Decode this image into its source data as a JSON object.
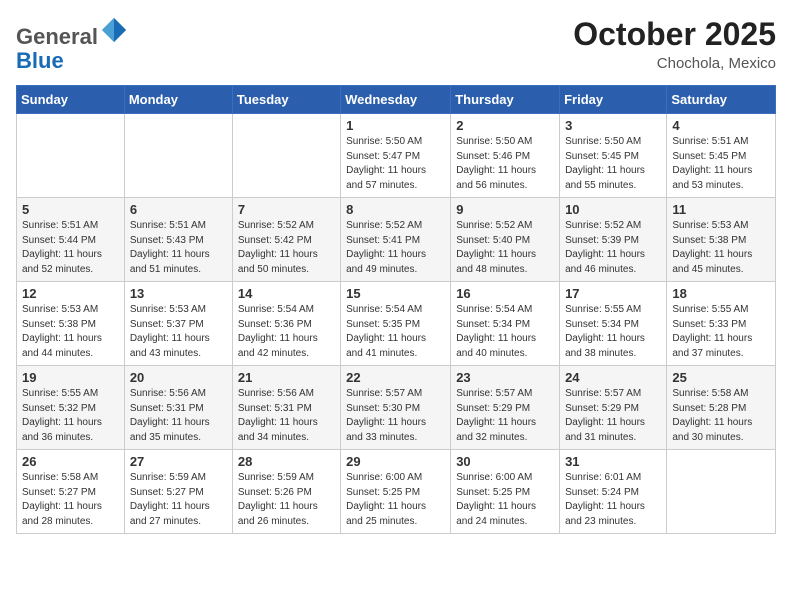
{
  "header": {
    "logo_general": "General",
    "logo_blue": "Blue",
    "month": "October 2025",
    "location": "Chochola, Mexico"
  },
  "weekdays": [
    "Sunday",
    "Monday",
    "Tuesday",
    "Wednesday",
    "Thursday",
    "Friday",
    "Saturday"
  ],
  "weeks": [
    [
      {
        "day": "",
        "info": ""
      },
      {
        "day": "",
        "info": ""
      },
      {
        "day": "",
        "info": ""
      },
      {
        "day": "1",
        "info": "Sunrise: 5:50 AM\nSunset: 5:47 PM\nDaylight: 11 hours\nand 57 minutes."
      },
      {
        "day": "2",
        "info": "Sunrise: 5:50 AM\nSunset: 5:46 PM\nDaylight: 11 hours\nand 56 minutes."
      },
      {
        "day": "3",
        "info": "Sunrise: 5:50 AM\nSunset: 5:45 PM\nDaylight: 11 hours\nand 55 minutes."
      },
      {
        "day": "4",
        "info": "Sunrise: 5:51 AM\nSunset: 5:45 PM\nDaylight: 11 hours\nand 53 minutes."
      }
    ],
    [
      {
        "day": "5",
        "info": "Sunrise: 5:51 AM\nSunset: 5:44 PM\nDaylight: 11 hours\nand 52 minutes."
      },
      {
        "day": "6",
        "info": "Sunrise: 5:51 AM\nSunset: 5:43 PM\nDaylight: 11 hours\nand 51 minutes."
      },
      {
        "day": "7",
        "info": "Sunrise: 5:52 AM\nSunset: 5:42 PM\nDaylight: 11 hours\nand 50 minutes."
      },
      {
        "day": "8",
        "info": "Sunrise: 5:52 AM\nSunset: 5:41 PM\nDaylight: 11 hours\nand 49 minutes."
      },
      {
        "day": "9",
        "info": "Sunrise: 5:52 AM\nSunset: 5:40 PM\nDaylight: 11 hours\nand 48 minutes."
      },
      {
        "day": "10",
        "info": "Sunrise: 5:52 AM\nSunset: 5:39 PM\nDaylight: 11 hours\nand 46 minutes."
      },
      {
        "day": "11",
        "info": "Sunrise: 5:53 AM\nSunset: 5:38 PM\nDaylight: 11 hours\nand 45 minutes."
      }
    ],
    [
      {
        "day": "12",
        "info": "Sunrise: 5:53 AM\nSunset: 5:38 PM\nDaylight: 11 hours\nand 44 minutes."
      },
      {
        "day": "13",
        "info": "Sunrise: 5:53 AM\nSunset: 5:37 PM\nDaylight: 11 hours\nand 43 minutes."
      },
      {
        "day": "14",
        "info": "Sunrise: 5:54 AM\nSunset: 5:36 PM\nDaylight: 11 hours\nand 42 minutes."
      },
      {
        "day": "15",
        "info": "Sunrise: 5:54 AM\nSunset: 5:35 PM\nDaylight: 11 hours\nand 41 minutes."
      },
      {
        "day": "16",
        "info": "Sunrise: 5:54 AM\nSunset: 5:34 PM\nDaylight: 11 hours\nand 40 minutes."
      },
      {
        "day": "17",
        "info": "Sunrise: 5:55 AM\nSunset: 5:34 PM\nDaylight: 11 hours\nand 38 minutes."
      },
      {
        "day": "18",
        "info": "Sunrise: 5:55 AM\nSunset: 5:33 PM\nDaylight: 11 hours\nand 37 minutes."
      }
    ],
    [
      {
        "day": "19",
        "info": "Sunrise: 5:55 AM\nSunset: 5:32 PM\nDaylight: 11 hours\nand 36 minutes."
      },
      {
        "day": "20",
        "info": "Sunrise: 5:56 AM\nSunset: 5:31 PM\nDaylight: 11 hours\nand 35 minutes."
      },
      {
        "day": "21",
        "info": "Sunrise: 5:56 AM\nSunset: 5:31 PM\nDaylight: 11 hours\nand 34 minutes."
      },
      {
        "day": "22",
        "info": "Sunrise: 5:57 AM\nSunset: 5:30 PM\nDaylight: 11 hours\nand 33 minutes."
      },
      {
        "day": "23",
        "info": "Sunrise: 5:57 AM\nSunset: 5:29 PM\nDaylight: 11 hours\nand 32 minutes."
      },
      {
        "day": "24",
        "info": "Sunrise: 5:57 AM\nSunset: 5:29 PM\nDaylight: 11 hours\nand 31 minutes."
      },
      {
        "day": "25",
        "info": "Sunrise: 5:58 AM\nSunset: 5:28 PM\nDaylight: 11 hours\nand 30 minutes."
      }
    ],
    [
      {
        "day": "26",
        "info": "Sunrise: 5:58 AM\nSunset: 5:27 PM\nDaylight: 11 hours\nand 28 minutes."
      },
      {
        "day": "27",
        "info": "Sunrise: 5:59 AM\nSunset: 5:27 PM\nDaylight: 11 hours\nand 27 minutes."
      },
      {
        "day": "28",
        "info": "Sunrise: 5:59 AM\nSunset: 5:26 PM\nDaylight: 11 hours\nand 26 minutes."
      },
      {
        "day": "29",
        "info": "Sunrise: 6:00 AM\nSunset: 5:25 PM\nDaylight: 11 hours\nand 25 minutes."
      },
      {
        "day": "30",
        "info": "Sunrise: 6:00 AM\nSunset: 5:25 PM\nDaylight: 11 hours\nand 24 minutes."
      },
      {
        "day": "31",
        "info": "Sunrise: 6:01 AM\nSunset: 5:24 PM\nDaylight: 11 hours\nand 23 minutes."
      },
      {
        "day": "",
        "info": ""
      }
    ]
  ]
}
